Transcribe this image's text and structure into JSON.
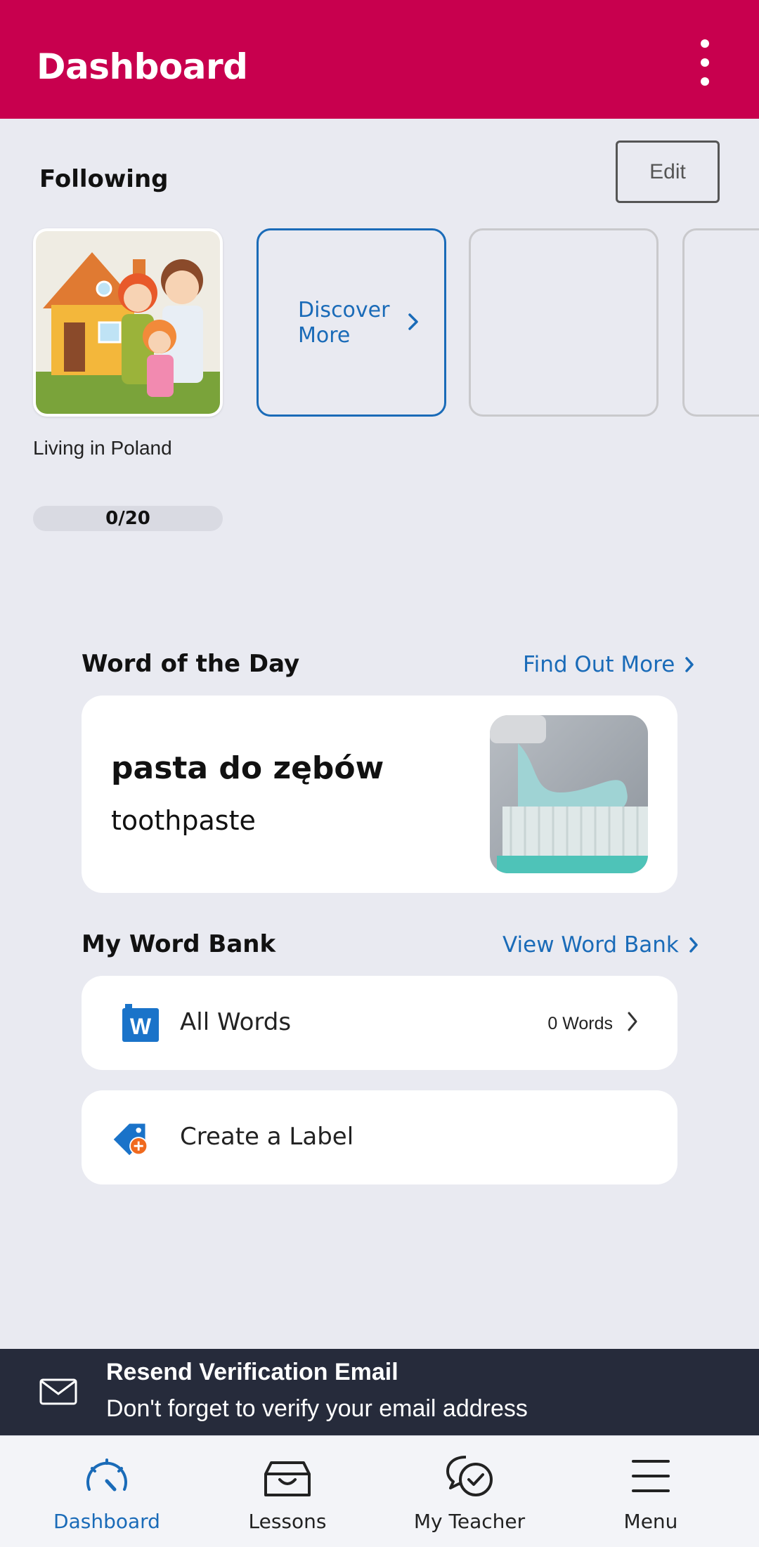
{
  "header": {
    "title": "Dashboard"
  },
  "following": {
    "title": "Following",
    "edit_label": "Edit",
    "course": {
      "name": "Living in Poland",
      "progress": "0/20"
    },
    "discover_label": "Discover More"
  },
  "word_of_day": {
    "title": "Word of the Day",
    "link": "Find Out More",
    "word": "pasta do zębów",
    "translation": "toothpaste"
  },
  "word_bank": {
    "title": "My Word Bank",
    "link": "View Word Bank",
    "all_words_label": "All Words",
    "all_words_count": "0 Words",
    "create_label": "Create a Label"
  },
  "banner": {
    "title": "Resend Verification Email",
    "subtitle": "Don't forget to verify your email address"
  },
  "tabs": [
    {
      "label": "Dashboard",
      "icon": "gauge-icon",
      "active": true
    },
    {
      "label": "Lessons",
      "icon": "inbox-box-icon",
      "active": false
    },
    {
      "label": "My Teacher",
      "icon": "chat-bubbles-icon",
      "active": false
    },
    {
      "label": "Menu",
      "icon": "hamburger-icon",
      "active": false
    }
  ],
  "colors": {
    "brand": "#c8004e",
    "link": "#1a6bb8",
    "banner": "#262b3b",
    "background": "#e9eaf1"
  }
}
